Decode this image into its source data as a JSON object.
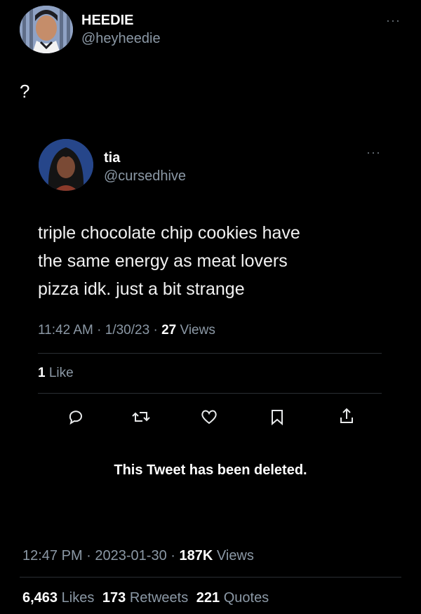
{
  "outer_tweet": {
    "display_name": "HEEDIE",
    "handle": "@heyheedie",
    "text": "?",
    "time": "12:47 PM",
    "sep1": "·",
    "date": "2023-01-30",
    "sep2": "·",
    "views_count": "187K",
    "views_label": "Views",
    "likes_count": "6,463",
    "likes_label": "Likes",
    "retweets_count": "173",
    "retweets_label": "Retweets",
    "quotes_count": "221",
    "quotes_label": "Quotes"
  },
  "quoted_tweet": {
    "display_name": "tia",
    "handle": "@cursedhive",
    "text_line1": "triple chocolate chip cookies have",
    "text_line2": "the same energy as meat lovers",
    "text_line3": "pizza idk. just a bit strange",
    "time": "11:42 AM",
    "sep1": "·",
    "date": "1/30/23",
    "sep2": "·",
    "views_count": "27",
    "views_label": "Views",
    "likes_count": "1",
    "likes_label": "Like",
    "actions": [
      "reply-icon",
      "retweet-icon",
      "like-icon",
      "bookmark-icon",
      "share-icon"
    ]
  },
  "deleted_notice": "This Tweet has been deleted.",
  "more_glyph": "···",
  "colors": {
    "background": "#000000",
    "text_primary": "#ffffff",
    "text_secondary": "#8b98a5",
    "divider": "#2a2e33"
  }
}
